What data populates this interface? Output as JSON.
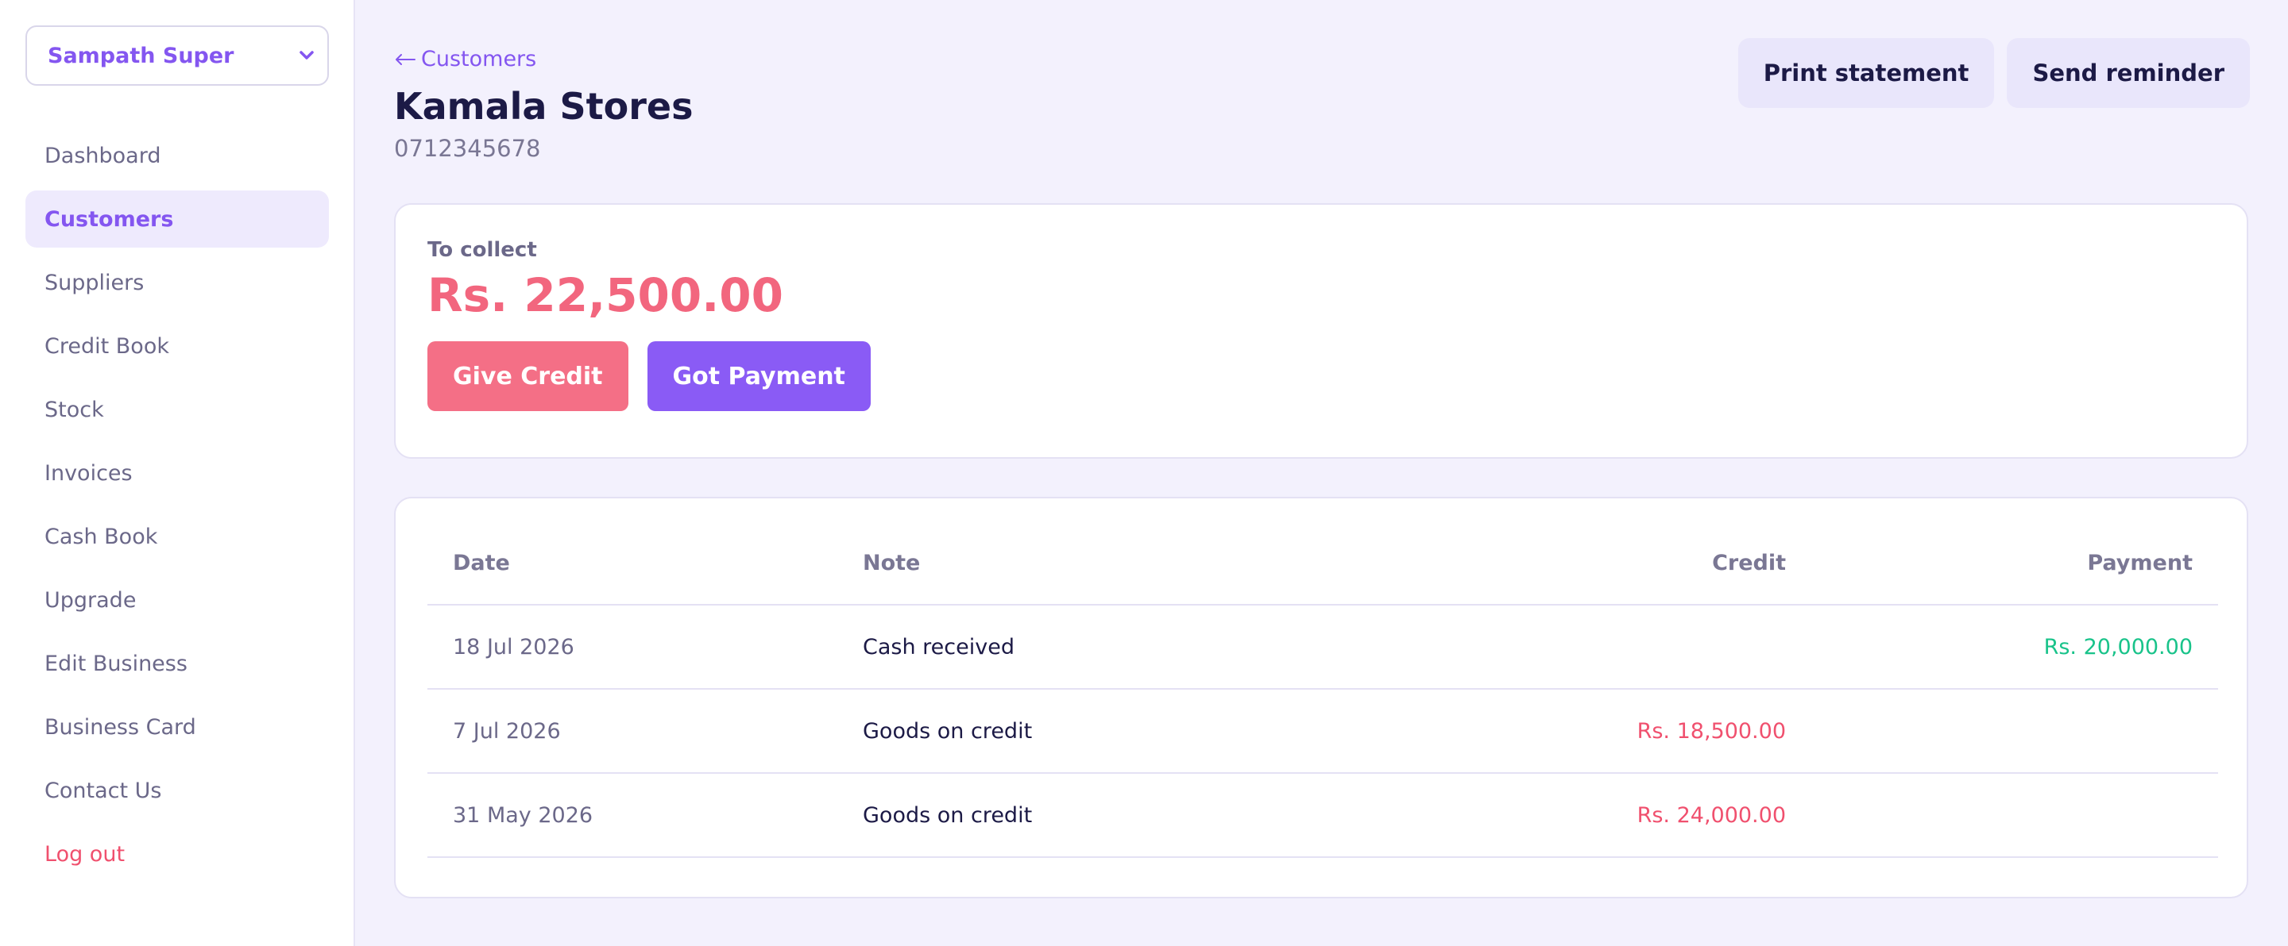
{
  "sidebar": {
    "business_name": "Sampath Super",
    "items": [
      {
        "label": "Dashboard"
      },
      {
        "label": "Customers"
      },
      {
        "label": "Suppliers"
      },
      {
        "label": "Credit Book"
      },
      {
        "label": "Stock"
      },
      {
        "label": "Invoices"
      },
      {
        "label": "Cash Book"
      },
      {
        "label": "Upgrade"
      },
      {
        "label": "Edit Business"
      },
      {
        "label": "Business Card"
      },
      {
        "label": "Contact Us"
      },
      {
        "label": "Log out"
      }
    ],
    "active_item": "Customers"
  },
  "header": {
    "back_label": "Customers",
    "title": "Kamala Stores",
    "phone": "0712345678",
    "print_label": "Print statement",
    "reminder_label": "Send reminder"
  },
  "summary": {
    "label": "To collect",
    "amount": "Rs. 22,500.00",
    "give_credit_label": "Give Credit",
    "got_payment_label": "Got Payment"
  },
  "transactions": {
    "columns": [
      "Date",
      "Note",
      "Credit",
      "Payment"
    ],
    "rows": [
      {
        "date": "18 Jul 2026",
        "note": "Cash received",
        "credit": "",
        "payment": "Rs. 20,000.00"
      },
      {
        "date": "7 Jul 2026",
        "note": "Goods on credit",
        "credit": "Rs. 18,500.00",
        "payment": ""
      },
      {
        "date": "31 May 2026",
        "note": "Goods on credit",
        "credit": "Rs. 24,000.00",
        "payment": ""
      }
    ]
  },
  "colors": {
    "accent": "#8456f0",
    "credit": "#f0506e",
    "payment": "#19c38a",
    "background": "#f3f1fd"
  }
}
